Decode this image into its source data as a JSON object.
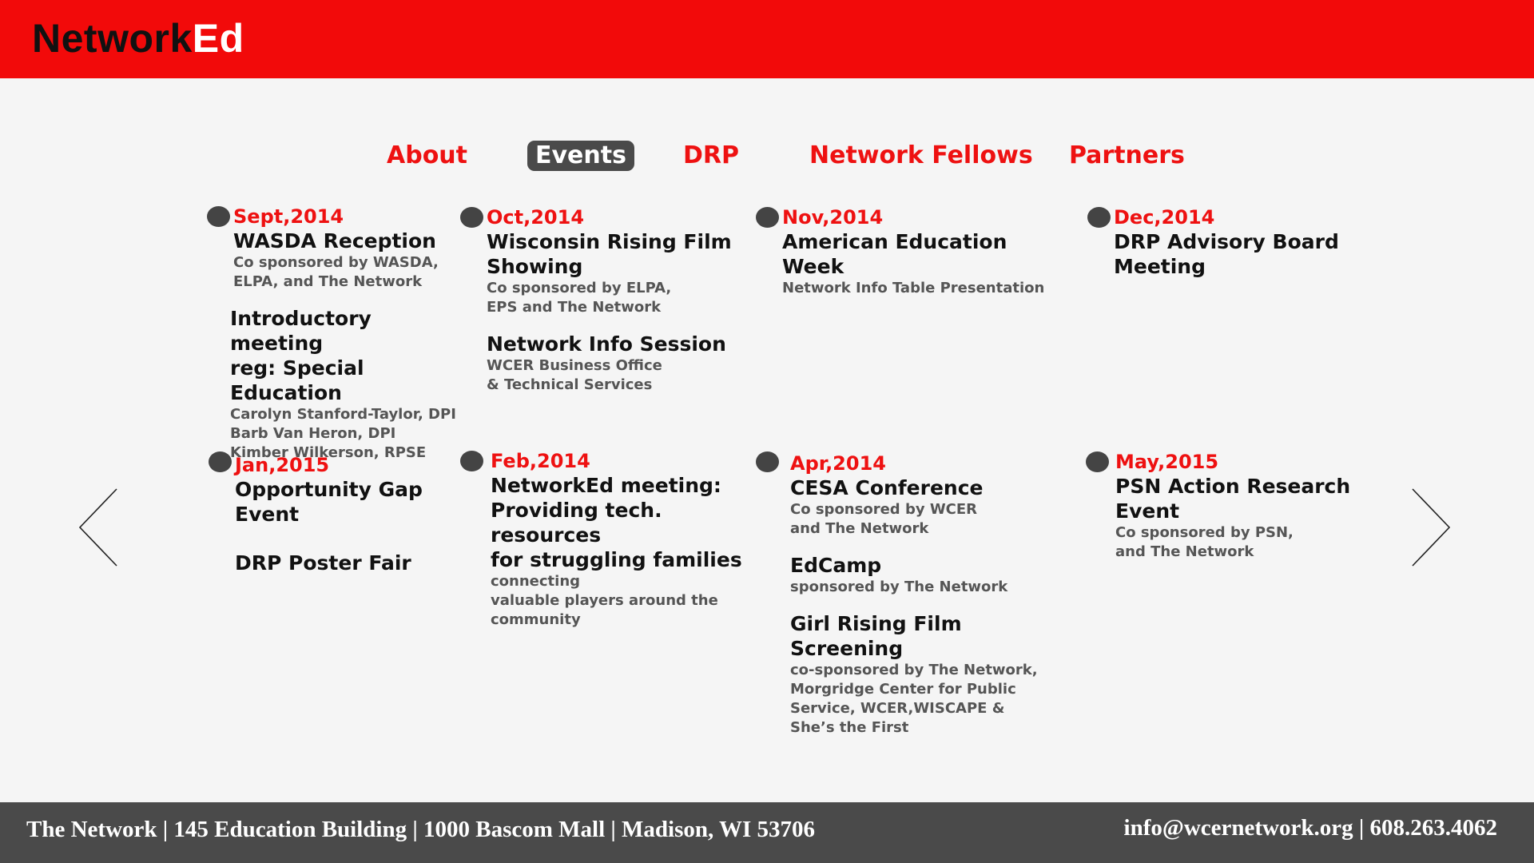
{
  "header": {
    "logo_part1": "Network",
    "logo_part2": "Ed"
  },
  "nav": {
    "items": [
      {
        "label": "About",
        "active": false
      },
      {
        "label": "Events",
        "active": true
      },
      {
        "label": "DRP",
        "active": false
      },
      {
        "label": "Network Fellows",
        "active": false
      },
      {
        "label": "Partners",
        "active": false
      }
    ]
  },
  "events": [
    {
      "date": "Sept,2014",
      "entries": [
        {
          "title": "WASDA Reception",
          "desc": "Co sponsored by WASDA,\nELPA, and The Network"
        },
        {
          "title": "Introductory meeting\nreg: Special Education",
          "desc": "Carolyn Stanford-Taylor, DPI\nBarb Van Heron, DPI\nKimber Wilkerson, RPSE"
        }
      ]
    },
    {
      "date": "Oct,2014",
      "entries": [
        {
          "title": "Wisconsin Rising Film\nShowing",
          "desc": "Co sponsored by ELPA,\nEPS and The Network"
        },
        {
          "title": "Network Info Session",
          "desc": "WCER Business Office\n& Technical Services"
        }
      ]
    },
    {
      "date": "Nov,2014",
      "entries": [
        {
          "title": "American Education Week",
          "desc": "Network Info Table Presentation"
        }
      ]
    },
    {
      "date": "Dec,2014",
      "entries": [
        {
          "title": "DRP Advisory Board Meeting",
          "desc": ""
        }
      ]
    },
    {
      "date": "Jan,2015",
      "entries": [
        {
          "title": "Opportunity Gap\nEvent",
          "desc": ""
        },
        {
          "title": "DRP Poster Fair",
          "desc": ""
        }
      ]
    },
    {
      "date": "Feb,2014",
      "entries": [
        {
          "title": "NetworkEd meeting:\nProviding tech. resources\nfor struggling families",
          "desc": "connecting\nvaluable players around the\ncommunity"
        }
      ]
    },
    {
      "date": "Apr,2014",
      "entries": [
        {
          "title": "CESA Conference",
          "desc": "Co sponsored by WCER\nand The Network"
        },
        {
          "title": "EdCamp",
          "desc": "sponsored by The Network"
        },
        {
          "title": "Girl Rising Film\nScreening",
          "desc": "co-sponsored by The Network,\n Morgridge Center for Public\nService, WCER,WISCAPE &\nShe’s the First"
        }
      ]
    },
    {
      "date": "May,2015",
      "entries": [
        {
          "title": "PSN Action Research Event",
          "desc": "Co sponsored by PSN,\nand The Network"
        }
      ]
    }
  ],
  "footer": {
    "address": "The Network | 145 Education Building | 1000 Bascom Mall | Madison, WI 53706",
    "contact": "info@wcernetwork.org  |  608.263.4062"
  }
}
